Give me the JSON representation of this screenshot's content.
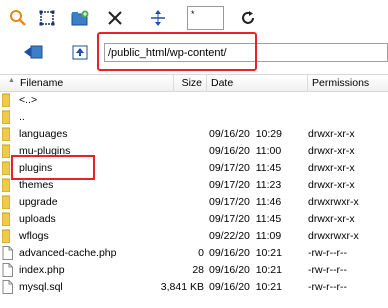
{
  "toolbar": {
    "filter_value": "*",
    "icons": [
      "search-icon",
      "select-icon",
      "new-folder-icon",
      "cut-icon",
      "align-icon",
      "refresh-icon",
      "back-icon",
      "up-folder-icon"
    ]
  },
  "path": {
    "value": "/public_html/wp-content/"
  },
  "columns": {
    "filename": "Filename",
    "size": "Size",
    "date": "Date",
    "permissions": "Permissions"
  },
  "files": [
    {
      "name": "<..>",
      "size": "",
      "date": "",
      "perm": "",
      "type": "folder"
    },
    {
      "name": "..",
      "size": "",
      "date": "",
      "perm": "",
      "type": "folder"
    },
    {
      "name": "languages",
      "size": "",
      "date": "09/16/20  10:29",
      "perm": "drwxr-xr-x",
      "type": "folder"
    },
    {
      "name": "mu-plugins",
      "size": "",
      "date": "09/16/20  11:00",
      "perm": "drwxr-xr-x",
      "type": "folder"
    },
    {
      "name": "plugins",
      "size": "",
      "date": "09/17/20  11:45",
      "perm": "drwxr-xr-x",
      "type": "folder"
    },
    {
      "name": "themes",
      "size": "",
      "date": "09/17/20  11:23",
      "perm": "drwxr-xr-x",
      "type": "folder"
    },
    {
      "name": "upgrade",
      "size": "",
      "date": "09/17/20  11:46",
      "perm": "drwxrwxr-x",
      "type": "folder"
    },
    {
      "name": "uploads",
      "size": "",
      "date": "09/17/20  11:45",
      "perm": "drwxr-xr-x",
      "type": "folder"
    },
    {
      "name": "wflogs",
      "size": "",
      "date": "09/22/20  11:09",
      "perm": "drwxrwxr-x",
      "type": "folder"
    },
    {
      "name": "advanced-cache.php",
      "size": "0",
      "date": "09/16/20  10:21",
      "perm": "-rw-r--r--",
      "type": "file"
    },
    {
      "name": "index.php",
      "size": "28",
      "date": "09/16/20  10:21",
      "perm": "-rw-r--r--",
      "type": "file"
    },
    {
      "name": "mysql.sql",
      "size": "3,841 KB",
      "date": "09/16/20  10:21",
      "perm": "-rw-r--r--",
      "type": "file"
    }
  ],
  "colors": {
    "highlight": "#e8212b",
    "folder": "#f2c94c"
  }
}
